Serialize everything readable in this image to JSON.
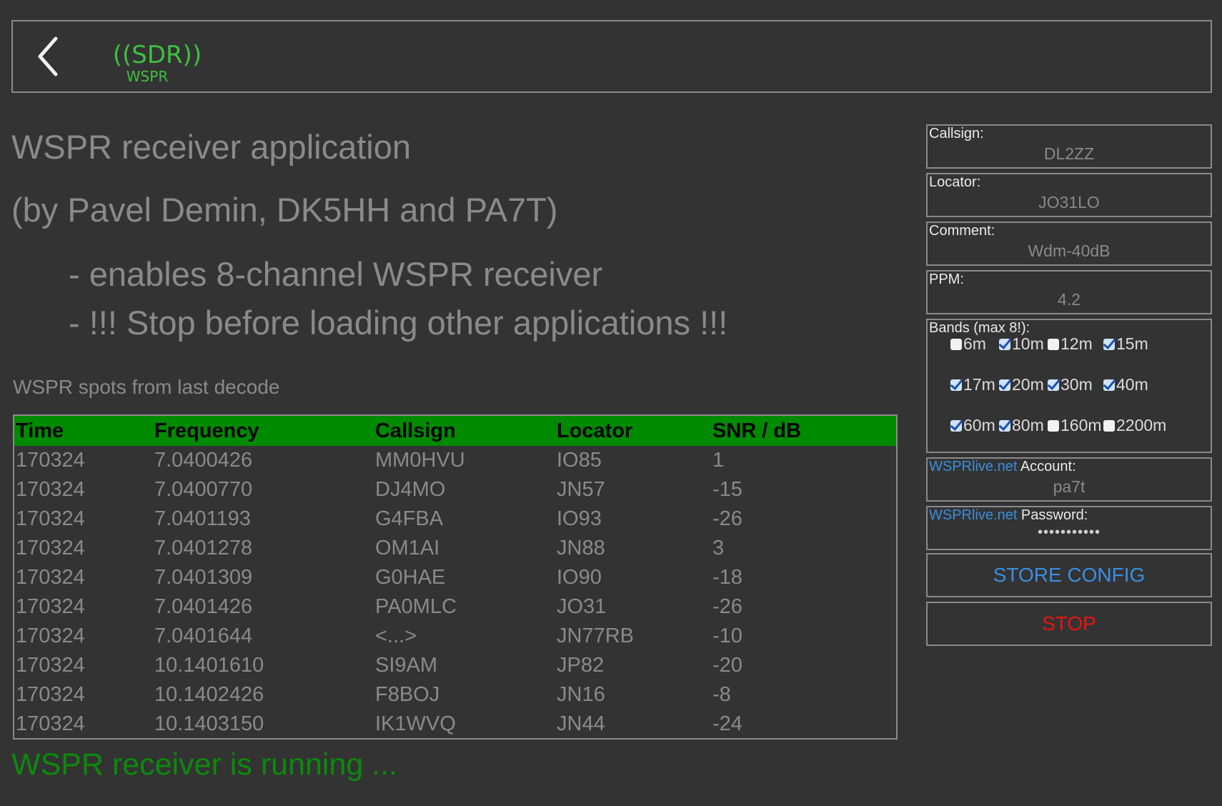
{
  "header": {
    "logo_main": "((SDR))",
    "logo_sub": "WSPR"
  },
  "intro": {
    "title": "WSPR receiver application",
    "subtitle": "(by Pavel Demin, DK5HH and PA7T)",
    "bullets": [
      "- enables 8-channel WSPR receiver",
      "- !!! Stop before loading other applications !!!"
    ]
  },
  "spots": {
    "heading": "WSPR spots from last decode",
    "columns": [
      "Time",
      "Frequency",
      "Callsign",
      "Locator",
      "SNR / dB"
    ],
    "rows": [
      [
        "170324",
        "7.0400426",
        "MM0HVU",
        "IO85",
        "1"
      ],
      [
        "170324",
        "7.0400770",
        "DJ4MO",
        "JN57",
        "-15"
      ],
      [
        "170324",
        "7.0401193",
        "G4FBA",
        "IO93",
        "-26"
      ],
      [
        "170324",
        "7.0401278",
        "OM1AI",
        "JN88",
        "3"
      ],
      [
        "170324",
        "7.0401309",
        "G0HAE",
        "IO90",
        "-18"
      ],
      [
        "170324",
        "7.0401426",
        "PA0MLC",
        "JO31",
        "-26"
      ],
      [
        "170324",
        "7.0401644",
        "<...>",
        "JN77RB",
        "-10"
      ],
      [
        "170324",
        "10.1401610",
        "SI9AM",
        "JP82",
        "-20"
      ],
      [
        "170324",
        "10.1402426",
        "F8BOJ",
        "JN16",
        "-8"
      ],
      [
        "170324",
        "10.1403150",
        "IK1WVQ",
        "JN44",
        "-24"
      ]
    ]
  },
  "status": "WSPR receiver is running ...",
  "config": {
    "callsign": {
      "label": "Callsign:",
      "value": "DL2ZZ"
    },
    "locator": {
      "label": "Locator:",
      "value": "JO31LO"
    },
    "comment": {
      "label": "Comment:",
      "value": "Wdm-40dB"
    },
    "ppm": {
      "label": "PPM:",
      "value": "4.2"
    },
    "bands": {
      "label": "Bands (max 8!):",
      "items": [
        {
          "label": "6m",
          "checked": false
        },
        {
          "label": "10m",
          "checked": true
        },
        {
          "label": "12m",
          "checked": false
        },
        {
          "label": "15m",
          "checked": true
        },
        {
          "label": "17m",
          "checked": true
        },
        {
          "label": "20m",
          "checked": true
        },
        {
          "label": "30m",
          "checked": true
        },
        {
          "label": "40m",
          "checked": true
        },
        {
          "label": "60m",
          "checked": true
        },
        {
          "label": "80m",
          "checked": true
        },
        {
          "label": "160m",
          "checked": false
        },
        {
          "label": "2200m",
          "checked": false
        }
      ]
    },
    "account": {
      "link": "WSPRlive.net",
      "label": " Account:",
      "value": "pa7t"
    },
    "password": {
      "link": "WSPRlive.net",
      "label": " Password:",
      "value": "•••••••••••"
    },
    "store_label": "STORE CONFIG",
    "stop_label": "STOP"
  },
  "colors": {
    "background": "#333333",
    "header_green": "#008a00",
    "status_green": "#0c8a0c",
    "link_blue": "#3a8fdf",
    "stop_red": "#e81414"
  }
}
